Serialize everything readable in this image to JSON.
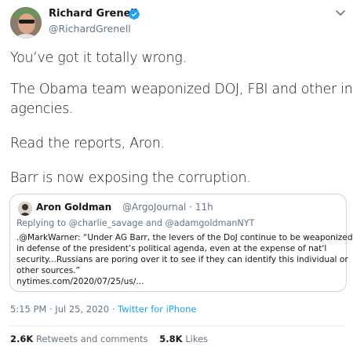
{
  "author": {
    "name": "Richard Grenell",
    "handle": "@RichardGrenell"
  },
  "tweet": {
    "lines": [
      "You’ve got it totally wrong.",
      "The Obama team weaponized DOJ, FBI and other intel",
      "agencies.",
      "Read the reports, Aron.",
      "Barr is now exposing the corruption."
    ]
  },
  "quoted": {
    "name": "Aron Goldman",
    "handle_time": "@ArgoJournal · 11h",
    "replying_prefix": "Replying to ",
    "replying_mentions": "@charlie_savage and @adamgoldmanNYT",
    "lines": [
      ".@MarkWarner: “Under AG Barr, the levers of the DoJ continue to be weaponized",
      "in defense of the president’s political agenda, even at the expense of nat'l",
      "security...Russians are poring over it to see if they can identify this individual or",
      "other sources.”",
      "nytimes.com/2020/07/25/us/..."
    ]
  },
  "meta": {
    "timestamp": "5:15 PM · Jul 25, 2020 · ",
    "source": "Twitter for iPhone"
  },
  "stats": {
    "retweets_count": "2.6K",
    "retweets_label": " Retweets and comments",
    "likes_count": "5.8K",
    "likes_label": " Likes"
  },
  "colors": {
    "verified": "#1da1f2",
    "muted": "#657786",
    "border": "#ccd6dd"
  }
}
